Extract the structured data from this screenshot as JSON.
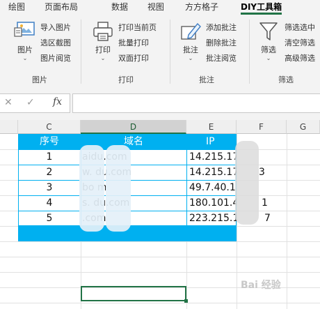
{
  "tabs": [
    "绘图",
    "页面布局",
    "数据",
    "视图",
    "方方格子",
    "DIY工具箱"
  ],
  "ribbon": {
    "picture_group": {
      "big_label": "图片",
      "items": [
        "导入图片",
        "选区截图",
        "图片阅览"
      ],
      "group_label": "图片"
    },
    "print_group": {
      "big_label": "打印",
      "items": [
        "打印当前页",
        "批量打印",
        "双面打印"
      ],
      "group_label": "打印"
    },
    "comment_group": {
      "big_label": "批注",
      "items": [
        "添加批注",
        "删除批注",
        "批注阅览"
      ],
      "group_label": "批注"
    },
    "filter_group": {
      "big_label": "筛选",
      "items": [
        "筛选选中",
        "清空筛选",
        "高级筛选"
      ],
      "group_label": "筛选"
    },
    "dropdown_glyph": "⌄"
  },
  "formula_bar": {
    "cancel_glyph": "✕",
    "confirm_glyph": "✓",
    "fx_label": "fx",
    "value": ""
  },
  "columns": [
    "C",
    "D",
    "E",
    "F",
    "G"
  ],
  "table": {
    "headers": [
      "序号",
      "域名",
      "IP"
    ],
    "rows": [
      [
        "1",
        "          aidu.com",
        "14.215.17"
      ],
      [
        "2",
        "w.        du.com",
        "14.215.17"
      ],
      [
        "3",
        "bo        m",
        "49.7.40.1"
      ],
      [
        "4",
        "s.        du.com",
        "180.101.4"
      ],
      [
        "5",
        "          .com",
        "223.215.18"
      ]
    ],
    "col_f_fragments": [
      "",
      "3",
      "",
      "1",
      "7"
    ]
  },
  "watermark": "Bai  经验",
  "colors": {
    "accent": "#217346",
    "table_header_bg": "#00b0f0",
    "table_border": "#00b0f0"
  }
}
